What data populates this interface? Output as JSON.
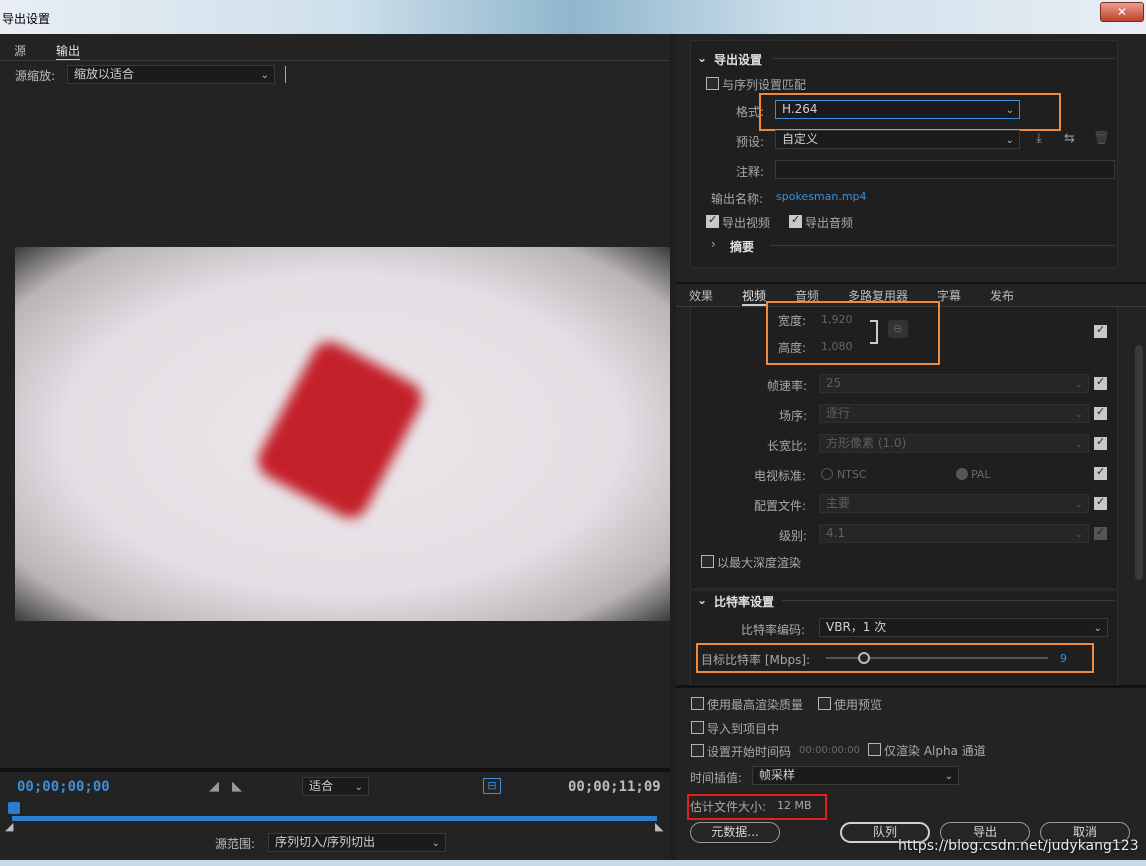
{
  "window": {
    "title": "导出设置",
    "close": "✕"
  },
  "left": {
    "tabs": [
      "源",
      "输出"
    ],
    "source_scale_label": "源缩放:",
    "source_scale_value": "缩放以适合",
    "timecode_start": "00;00;00;00",
    "timecode_end": "00;00;11;09",
    "fit_value": "适合",
    "source_range_label": "源范围:",
    "source_range_value": "序列切入/序列切出"
  },
  "export": {
    "section_title": "导出设置",
    "match_sequence": "与序列设置匹配",
    "format_label": "格式:",
    "format_value": "H.264",
    "preset_label": "预设:",
    "preset_value": "自定义",
    "comment_label": "注释:",
    "comment_value": "",
    "output_name_label": "输出名称:",
    "output_name_value": "spokesman.mp4",
    "export_video": "导出视频",
    "export_audio": "导出音频",
    "summary": "摘要"
  },
  "subtabs": [
    "效果",
    "视频",
    "音频",
    "多路复用器",
    "字幕",
    "发布"
  ],
  "video": {
    "width_label": "宽度:",
    "width_value": "1,920",
    "height_label": "高度:",
    "height_value": "1,080",
    "fps_label": "帧速率:",
    "fps_value": "25",
    "field_label": "场序:",
    "field_value": "逐行",
    "aspect_label": "长宽比:",
    "aspect_value": "方形像素 (1.0)",
    "tv_label": "电视标准:",
    "tv_ntsc": "NTSC",
    "tv_pal": "PAL",
    "profile_label": "配置文件:",
    "profile_value": "主要",
    "level_label": "级别:",
    "level_value": "4.1",
    "max_depth": "以最大深度渲染"
  },
  "bitrate": {
    "section_title": "比特率设置",
    "encoding_label": "比特率编码:",
    "encoding_value": "VBR，1 次",
    "target_label": "目标比特率 [Mbps]:",
    "target_value": "9",
    "target_fraction": 0.17
  },
  "bottom": {
    "max_render": "使用最高渲染质量",
    "use_preview": "使用预览",
    "import_project": "导入到项目中",
    "set_start_tc": "设置开始时间码",
    "start_tc_value": "00:00:00:00",
    "alpha_only": "仅渲染 Alpha 通道",
    "interp_label": "时间插值:",
    "interp_value": "帧采样",
    "filesize_label": "估计文件大小:",
    "filesize_value": "12 MB",
    "metadata_btn": "元数据...",
    "queue_btn": "队列",
    "export_btn": "导出",
    "cancel_btn": "取消"
  },
  "watermark": "https://blog.csdn.net/judykang123",
  "colors": {
    "accent": "#3d8fd8",
    "highlight_orange": "#f08a3a",
    "highlight_red": "#e02020"
  }
}
